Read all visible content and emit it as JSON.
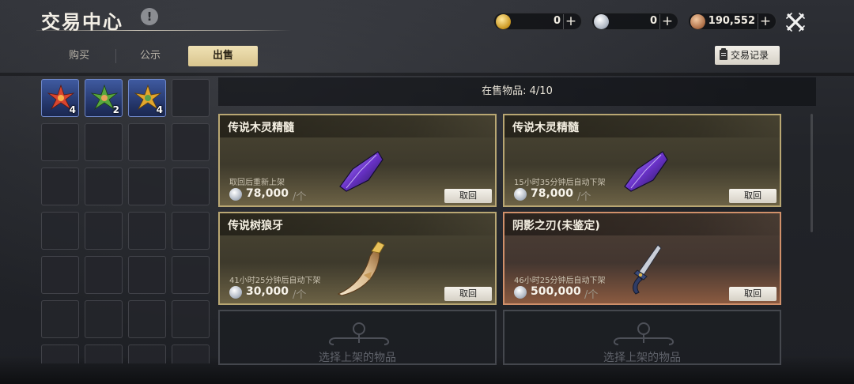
{
  "header": {
    "title": "交易中心",
    "info_icon": "!",
    "currencies": [
      {
        "icon": "gold-coin-icon",
        "amount": "0"
      },
      {
        "icon": "silver-coin-icon",
        "amount": "0"
      },
      {
        "icon": "bronze-coin-icon",
        "amount": "190,552"
      }
    ],
    "plus_symbol": "+"
  },
  "tabs": [
    {
      "label": "购买",
      "active": false
    },
    {
      "label": "公示",
      "active": false
    },
    {
      "label": "出售",
      "active": true
    }
  ],
  "history_button": "交易记录",
  "inventory": {
    "items": [
      {
        "name": "red-crystal-flower",
        "count": "4",
        "color": "#d9452f"
      },
      {
        "name": "green-crystal-flower",
        "count": "2",
        "color": "#58a83e"
      },
      {
        "name": "gold-crystal-flower",
        "count": "4",
        "color": "#e2a62e"
      }
    ]
  },
  "listing": {
    "header": "在售物品: 4/10",
    "unit_suffix": "/个",
    "retrieve_label": "取回",
    "cards": [
      {
        "name": "传说木灵精髓",
        "status": "取回后重新上架",
        "price": "78,000",
        "rarity": "gold",
        "art": "purple-crystal"
      },
      {
        "name": "传说木灵精髓",
        "status": "15小时35分钟后自动下架",
        "price": "78,000",
        "rarity": "gold",
        "art": "purple-crystal"
      },
      {
        "name": "传说树狼牙",
        "status": "41小时25分钟后自动下架",
        "price": "30,000",
        "rarity": "gold",
        "art": "wolf-fang"
      },
      {
        "name": "阴影之刃(未鉴定)",
        "status": "46小时25分钟后自动下架",
        "price": "500,000",
        "rarity": "orange",
        "art": "shadow-blade"
      }
    ],
    "empty_slots": [
      {
        "text": "选择上架的物品"
      },
      {
        "text": "选择上架的物品"
      }
    ]
  }
}
